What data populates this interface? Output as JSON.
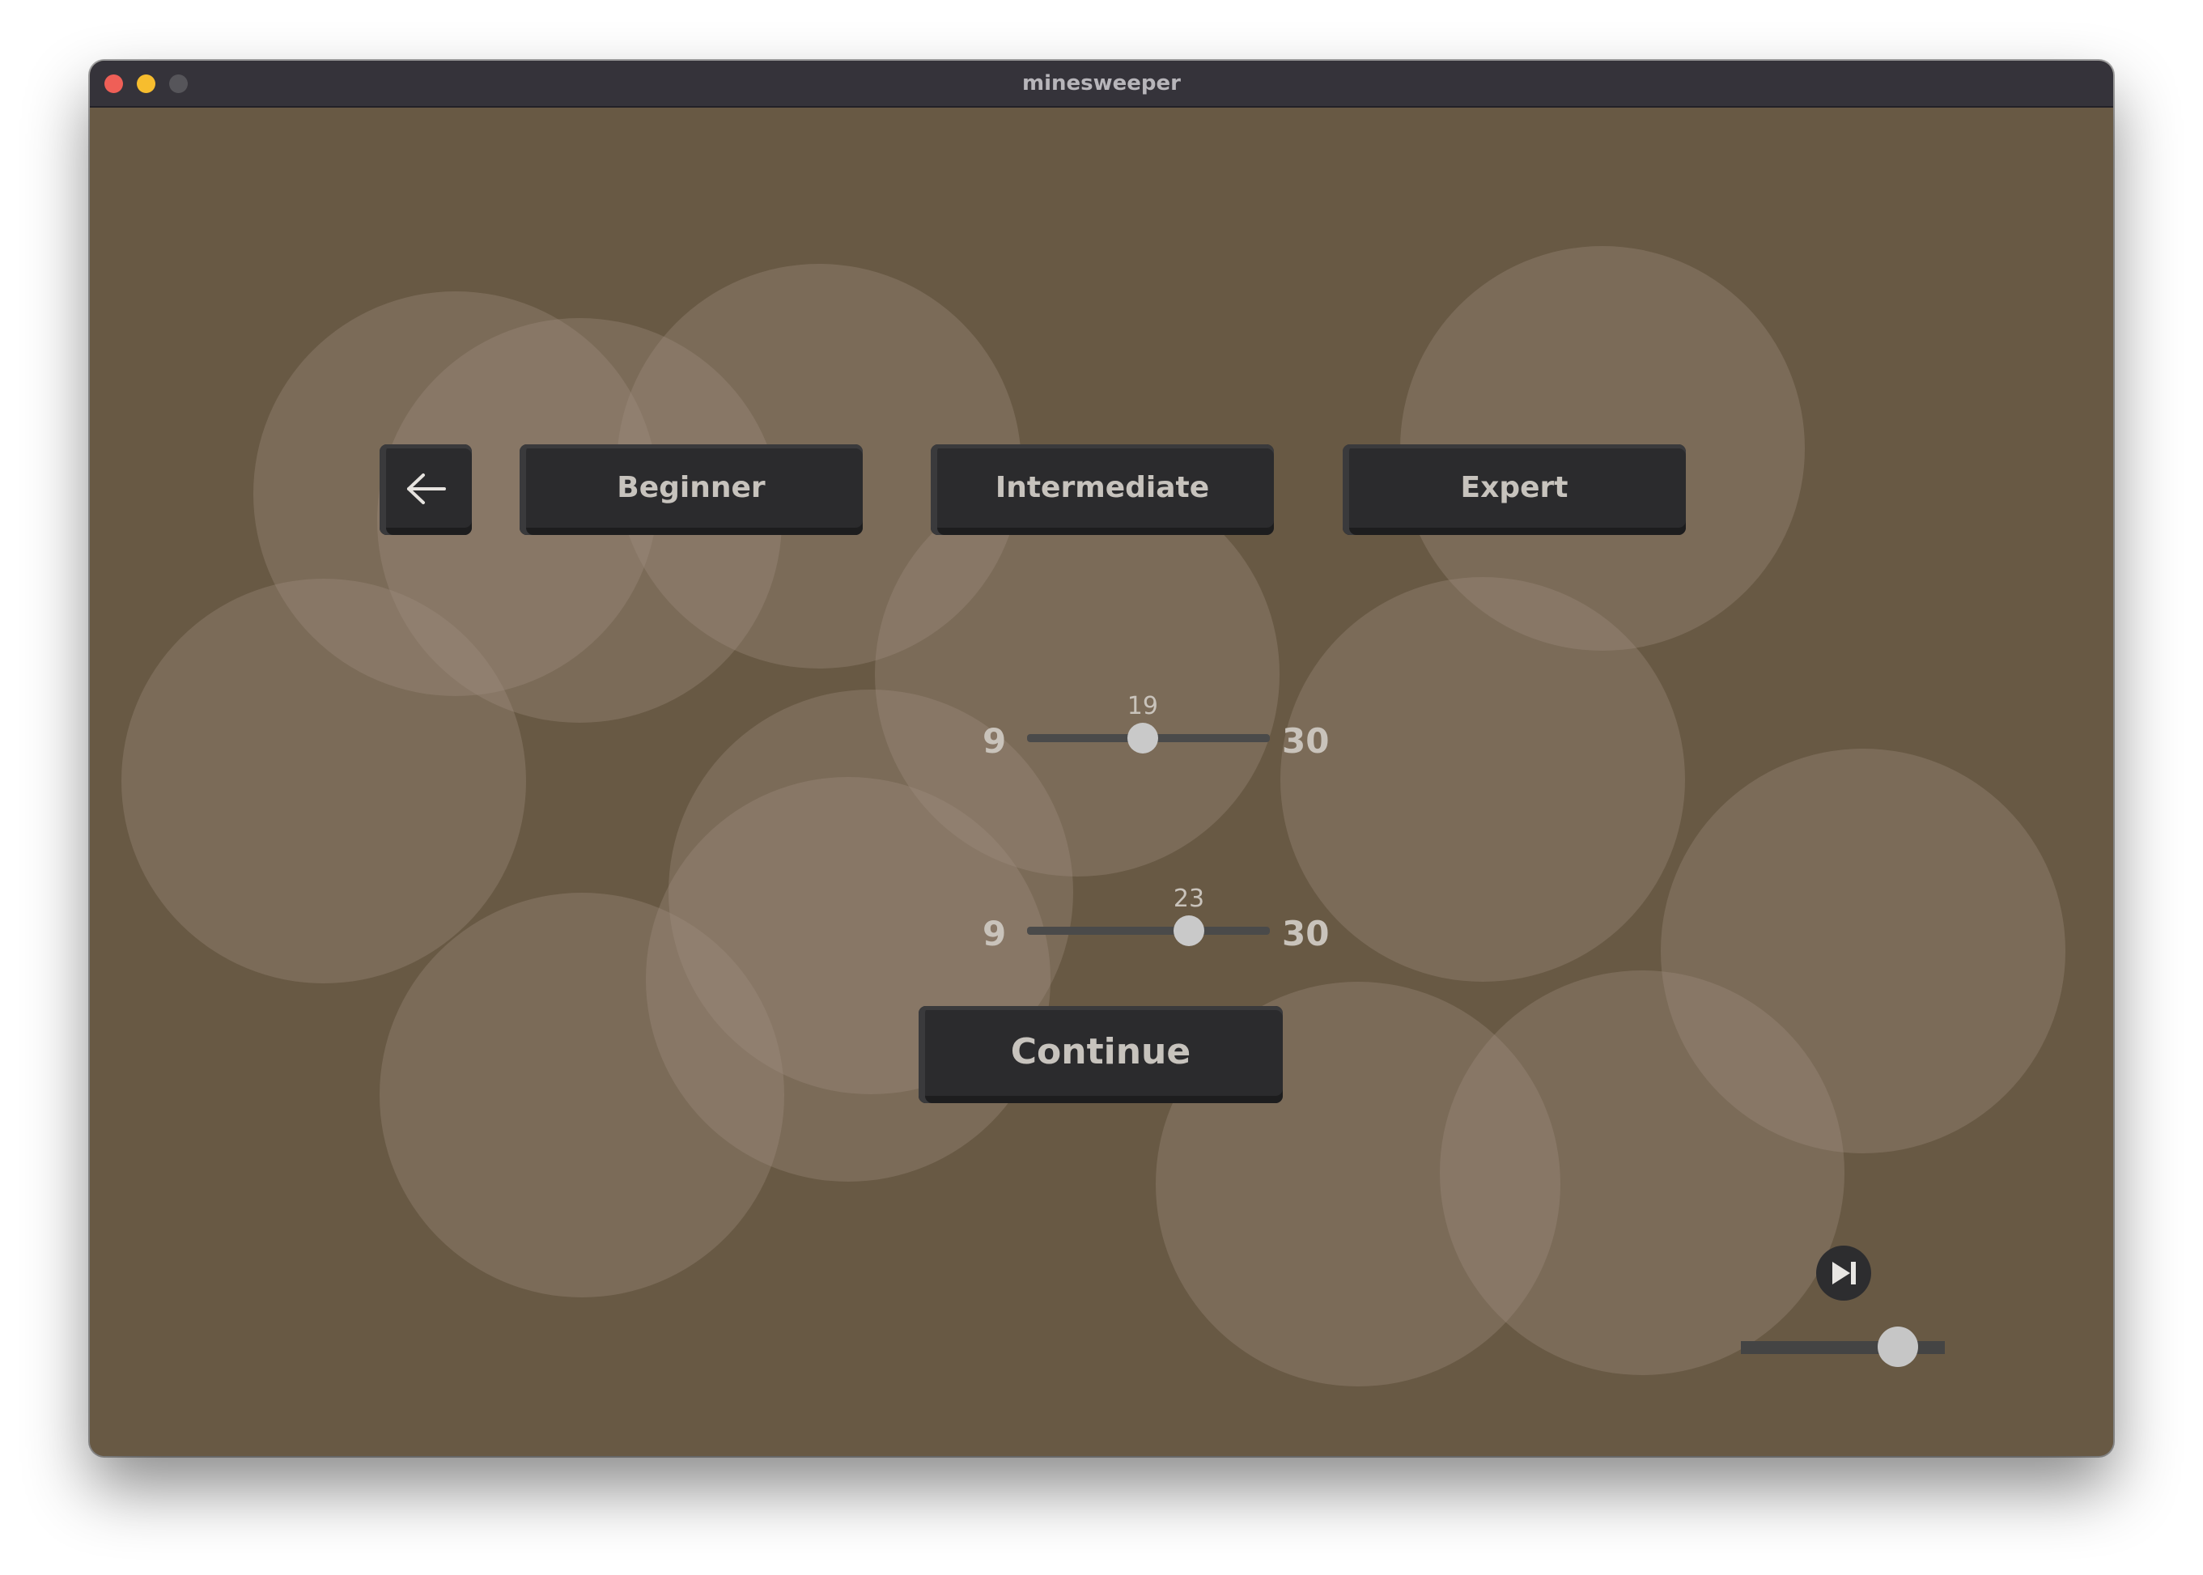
{
  "window": {
    "title": "minesweeper"
  },
  "toolbar": {
    "back_icon": "arrow-left-icon",
    "presets": [
      {
        "label": "Beginner"
      },
      {
        "label": "Intermediate"
      },
      {
        "label": "Expert"
      }
    ]
  },
  "sliders": [
    {
      "name": "first",
      "min": 9,
      "max": 30,
      "value": 19,
      "min_label": "9",
      "max_label": "30",
      "value_label": "19"
    },
    {
      "name": "second",
      "min": 9,
      "max": 30,
      "value": 23,
      "min_label": "9",
      "max_label": "30",
      "value_label": "23"
    }
  ],
  "actions": {
    "continue_label": "Continue"
  },
  "audio": {
    "skip_icon": "skip-forward-icon",
    "volume": 0.77
  },
  "colors": {
    "background": "#685944",
    "button": "#2b2b2d",
    "button_text": "#c7c3bd",
    "bubble": "rgba(160,145,128,0.34)",
    "titlebar": "#35333a"
  }
}
